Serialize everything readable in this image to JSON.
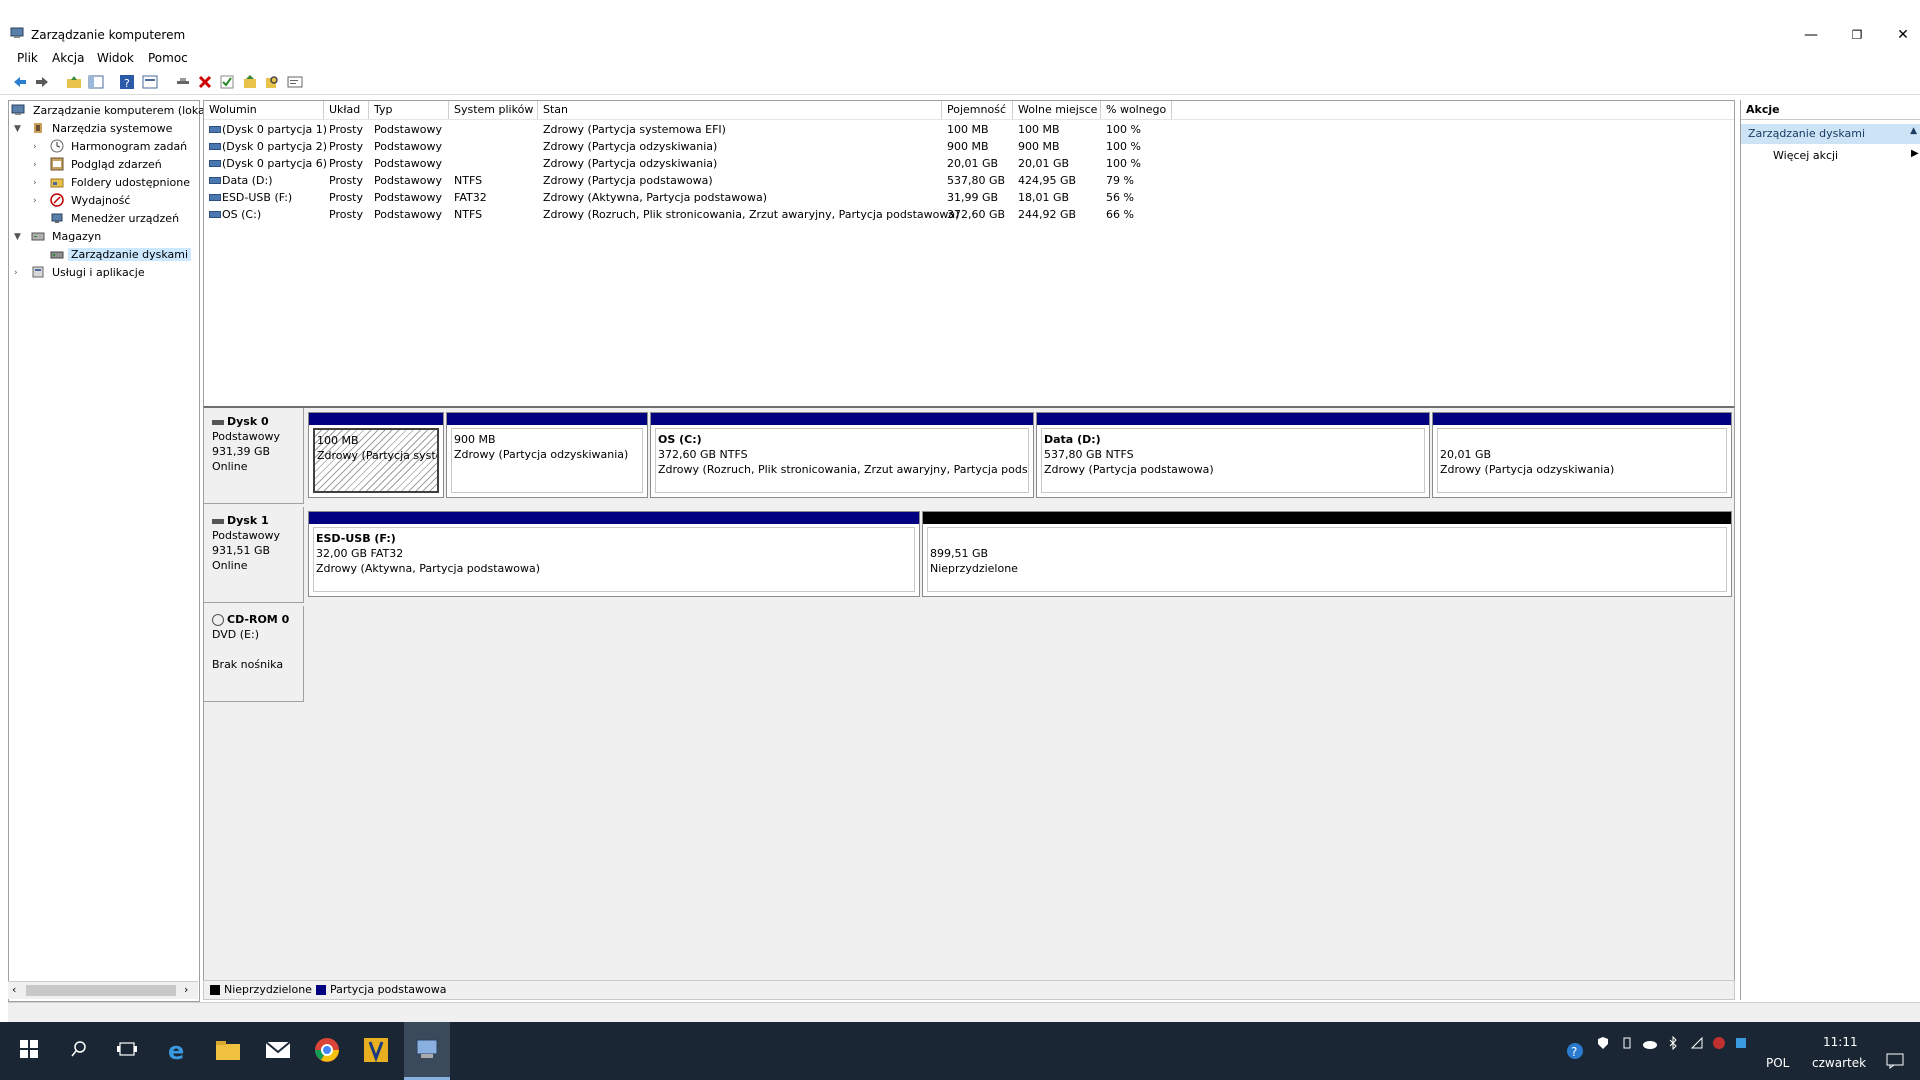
{
  "window": {
    "title": "Zarządzanie komputerem",
    "controls": {
      "minimize": "—",
      "restore": "❐",
      "close": "✕"
    }
  },
  "menu": [
    "Plik",
    "Akcja",
    "Widok",
    "Pomoc"
  ],
  "toolbar_icons": [
    "back-arrow-icon",
    "forward-arrow-icon",
    "up-folder-icon",
    "show-hide-tree-icon",
    "help-icon",
    "view-icon",
    "connect-icon",
    "delete-icon",
    "check-icon",
    "export-icon",
    "search-icon",
    "properties-icon"
  ],
  "tree": {
    "root": "Zarządzanie komputerem (loka",
    "system_tools": "Narzędzia systemowe",
    "task_scheduler": "Harmonogram zadań",
    "event_viewer": "Podgląd zdarzeń",
    "shared_folders": "Foldery udostępnione",
    "performance": "Wydajność",
    "device_manager": "Menedżer urządzeń",
    "storage": "Magazyn",
    "disk_management": "Zarządzanie dyskami",
    "services": "Usługi i aplikacje"
  },
  "volumes": {
    "headers": [
      "Wolumin",
      "Układ",
      "Typ",
      "System plików",
      "Stan",
      "Pojemność",
      "Wolne miejsce",
      "% wolnego"
    ],
    "rows": [
      {
        "name": "(Dysk 0 partycja 1)",
        "layout": "Prosty",
        "type": "Podstawowy",
        "fs": "",
        "status": "Zdrowy (Partycja systemowa EFI)",
        "capacity": "100 MB",
        "free": "100 MB",
        "pct": "100 %"
      },
      {
        "name": "(Dysk 0 partycja 2)",
        "layout": "Prosty",
        "type": "Podstawowy",
        "fs": "",
        "status": "Zdrowy (Partycja odzyskiwania)",
        "capacity": "900 MB",
        "free": "900 MB",
        "pct": "100 %"
      },
      {
        "name": "(Dysk 0 partycja 6)",
        "layout": "Prosty",
        "type": "Podstawowy",
        "fs": "",
        "status": "Zdrowy (Partycja odzyskiwania)",
        "capacity": "20,01 GB",
        "free": "20,01 GB",
        "pct": "100 %"
      },
      {
        "name": "Data (D:)",
        "layout": "Prosty",
        "type": "Podstawowy",
        "fs": "NTFS",
        "status": "Zdrowy (Partycja podstawowa)",
        "capacity": "537,80 GB",
        "free": "424,95 GB",
        "pct": "79 %"
      },
      {
        "name": "ESD-USB (F:)",
        "layout": "Prosty",
        "type": "Podstawowy",
        "fs": "FAT32",
        "status": "Zdrowy (Aktywna, Partycja podstawowa)",
        "capacity": "31,99 GB",
        "free": "18,01 GB",
        "pct": "56 %"
      },
      {
        "name": "OS (C:)",
        "layout": "Prosty",
        "type": "Podstawowy",
        "fs": "NTFS",
        "status": "Zdrowy (Rozruch, Plik stronicowania, Zrzut awaryjny, Partycja podstawowa)",
        "capacity": "372,60 GB",
        "free": "244,92 GB",
        "pct": "66 %"
      }
    ]
  },
  "disks": {
    "disk0": {
      "name": "Dysk 0",
      "type": "Podstawowy",
      "size": "931,39 GB",
      "state": "Online",
      "p1": {
        "size": "100 MB",
        "status": "Zdrowy (Partycja syster"
      },
      "p2": {
        "size": "900 MB",
        "status": "Zdrowy (Partycja odzyskiwania)"
      },
      "p3": {
        "label": "OS  (C:)",
        "size": "372,60 GB NTFS",
        "status": "Zdrowy (Rozruch, Plik stronicowania, Zrzut awaryjny, Partycja podstaw"
      },
      "p4": {
        "label": "Data  (D:)",
        "size": "537,80 GB NTFS",
        "status": "Zdrowy (Partycja podstawowa)"
      },
      "p5": {
        "size": "20,01 GB",
        "status": "Zdrowy (Partycja odzyskiwania)"
      }
    },
    "disk1": {
      "name": "Dysk 1",
      "type": "Podstawowy",
      "size": "931,51 GB",
      "state": "Online",
      "p1": {
        "label": "ESD-USB  (F:)",
        "size": "32,00 GB FAT32",
        "status": "Zdrowy (Aktywna, Partycja podstawowa)"
      },
      "p2": {
        "size": "899,51 GB",
        "status": "Nieprzydzielone"
      }
    },
    "cdrom": {
      "name": "CD-ROM 0",
      "type": "DVD (E:)",
      "state": "Brak nośnika"
    }
  },
  "legend": {
    "unallocated": "Nieprzydzielone",
    "primary": "Partycja podstawowa"
  },
  "actions": {
    "title": "Akcje",
    "section": "Zarządzanie dyskami",
    "more": "Więcej akcji"
  },
  "taskbar": {
    "apps": [
      "edge-icon",
      "file-explorer-icon",
      "mail-icon",
      "chrome-icon",
      "app-icon",
      "computer-management-icon"
    ],
    "lang": "POL",
    "time": "11:11",
    "day": "czwartek"
  },
  "colors": {
    "primary_partition": "#000080",
    "unallocated": "#000000",
    "taskbar": "#1a2633",
    "selection": "#cce8ff"
  }
}
